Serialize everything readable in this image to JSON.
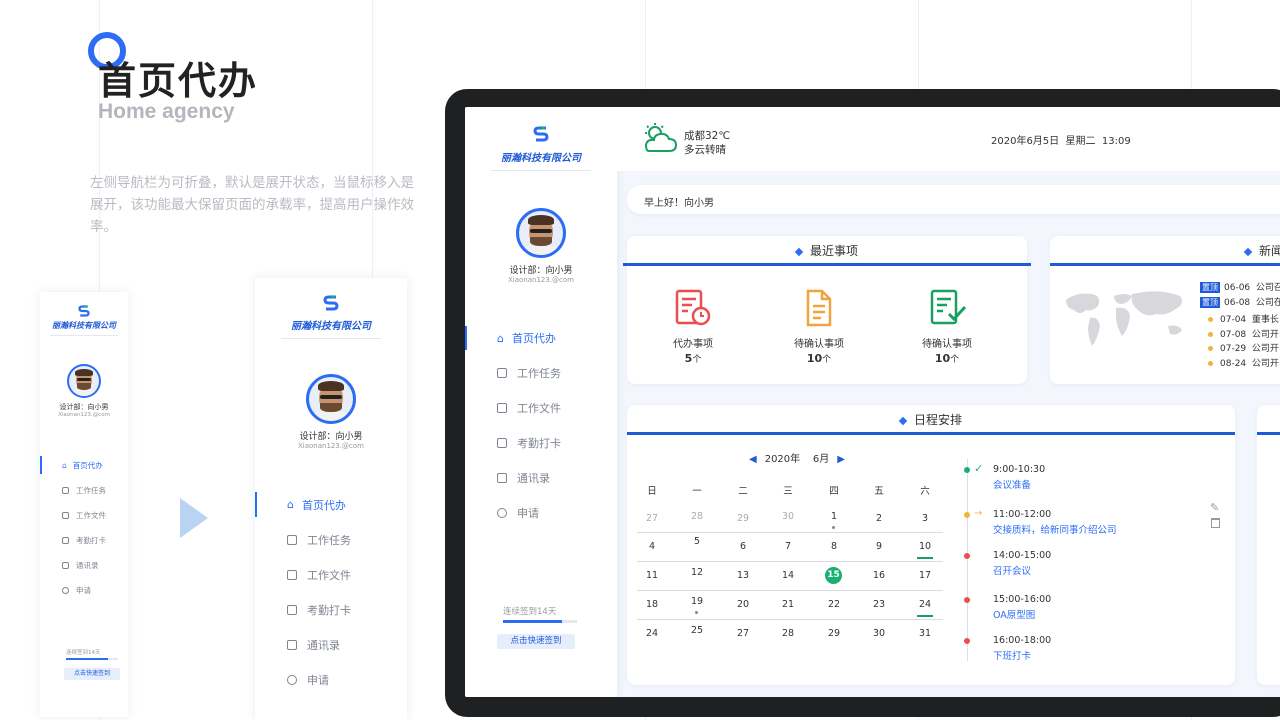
{
  "heading": {
    "title": "首页代办",
    "subtitle": "Home agency",
    "description": "左侧导航栏为可折叠，默认是展开状态，当鼠标移入是展开，该功能最大保留页面的承载率，提高用户操作效率。"
  },
  "brand": {
    "name": "丽瀚科技有限公司",
    "accent": "#2d6df6",
    "dark_blue": "#1f5bd8"
  },
  "user": {
    "label": "设计部：向小男",
    "email": "Xiaonan123.@com"
  },
  "nav": [
    {
      "label": "首页代办",
      "icon": "home-icon"
    },
    {
      "label": "工作任务",
      "icon": "task-icon"
    },
    {
      "label": "工作文件",
      "icon": "file-icon"
    },
    {
      "label": "考勤打卡",
      "icon": "calendar-check-icon"
    },
    {
      "label": "通讯录",
      "icon": "contacts-icon"
    },
    {
      "label": "申请",
      "icon": "apply-icon"
    }
  ],
  "checkin": {
    "streak": "连续签到14天",
    "streak_fill": 0.8,
    "button": "点击快速签到"
  },
  "weather": {
    "city_temp": "成都32℃",
    "desc": "多云转晴",
    "icon": "cloud-sun-icon"
  },
  "datetime": "2020年6月5日  星期二  13:09",
  "greeting": "早上好！向小男",
  "recent": {
    "title": "最近事项",
    "items": [
      {
        "label": "代办事项",
        "count": "5",
        "unit": "个",
        "icon": "clock-doc-icon"
      },
      {
        "label": "待确认事项",
        "count": "10",
        "unit": "个",
        "icon": "document-icon"
      },
      {
        "label": "待确认事项",
        "count": "10",
        "unit": "个",
        "icon": "checklist-icon"
      }
    ]
  },
  "news": {
    "title": "新闻",
    "items": [
      {
        "tag": "置顶",
        "date": "06-06",
        "text": "公司召"
      },
      {
        "tag": "置顶",
        "date": "06-08",
        "text": "公司在"
      },
      {
        "tag": "",
        "date": "07-04",
        "text": "董事长"
      },
      {
        "tag": "",
        "date": "07-08",
        "text": "公司开"
      },
      {
        "tag": "",
        "date": "07-29",
        "text": "公司开"
      },
      {
        "tag": "",
        "date": "08-24",
        "text": "公司开"
      }
    ]
  },
  "schedule": {
    "title": "日程安排",
    "year": "2020年",
    "month": "6月",
    "weekdays": [
      "日",
      "一",
      "二",
      "三",
      "四",
      "五",
      "六"
    ],
    "weeks": [
      [
        "27",
        "28",
        "29",
        "30",
        "1",
        "2",
        "3"
      ],
      [
        "4",
        "5",
        "6",
        "7",
        "8",
        "9",
        "10"
      ],
      [
        "11",
        "12",
        "13",
        "14",
        "15",
        "16",
        "17"
      ],
      [
        "18",
        "19",
        "20",
        "21",
        "22",
        "23",
        "24"
      ],
      [
        "24",
        "25",
        "27",
        "28",
        "29",
        "30",
        "31"
      ]
    ],
    "today": "15",
    "events": [
      {
        "time": "9:00-10:30",
        "title": "会议准备",
        "status": "done",
        "color": "#17b173"
      },
      {
        "time": "11:00-12:00",
        "title": "交接质料，给新同事介绍公司",
        "status": "current",
        "color": "#f2b33d"
      },
      {
        "time": "14:00-15:00",
        "title": "召开会议",
        "status": "upcoming",
        "color": "#ee4d4d"
      },
      {
        "time": "15:00-16:00",
        "title": "OA原型图",
        "status": "upcoming",
        "color": "#ee4d4d"
      },
      {
        "time": "16:00-18:00",
        "title": "下班打卡",
        "status": "upcoming",
        "color": "#ee4d4d"
      }
    ]
  }
}
